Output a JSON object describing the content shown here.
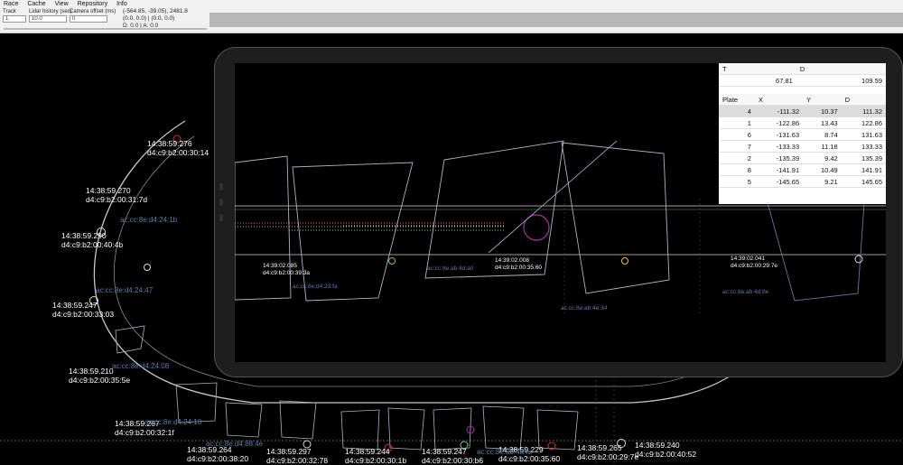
{
  "menu": [
    "Race",
    "Cache",
    "View",
    "Repository",
    "Info"
  ],
  "controls": {
    "track_label": "Track",
    "track_value": "1",
    "lidar_label": "Lidar history (sec)",
    "lidar_value": "10.0",
    "camera_label": "Camera offset (ms)",
    "camera_value": "0",
    "readout_line1": "(-564.85, -39.05), 2481.8",
    "readout_line2": "(0.0, 0.0) | (0.0, 0.0)",
    "readout_line3": "D: 0.0 | A: 0.0"
  },
  "scene_labels": [
    {
      "time": "14:38:59.276",
      "id": "d4:c9:b2:00:30:14"
    },
    {
      "time": "14:38:59.270",
      "id": "d4:c9:b2:00:31:7d"
    },
    {
      "time": "14:38:59.290",
      "id": "d4:c9:b2:00:40:4b"
    },
    {
      "time": "14:38:59.247",
      "id": "d4:c9:b2:00:33:03"
    },
    {
      "time": "14:38:59.210",
      "id": "d4:c9:b2:00:35:5e"
    },
    {
      "time": "14:38:59.267",
      "id": "d4:c9:b2:00:32:1f"
    },
    {
      "time": "14:38:59.264",
      "id": "d4:c9:b2:00:38:20"
    },
    {
      "time": "14:38:59.297",
      "id": "d4:c9:b2:00:32:78"
    },
    {
      "time": "14:38:59.244",
      "id": "d4:c9:b2:00:30:1b"
    },
    {
      "time": "14:38:59.247",
      "id": "d4:c9:b2:00:30:b6"
    },
    {
      "time": "14:38:59.229",
      "id": "d4:c9:b2:00:35:60"
    },
    {
      "time": "14:38:59.265",
      "id": "d4:c9:b2:00:29:7e"
    },
    {
      "time": "14:38:59.240",
      "id": "d4:c9:b2:00:40:52"
    }
  ],
  "scene_macs": [
    "ac:cc:8e:d4:24:1b",
    "ac:cc:8e:d4:24:47",
    "ac:cc:8e:d4:24:08",
    "ac:cc:8e:d4:24:10",
    "ac:cc:8e:d4:88:4e",
    "ac:cc:8e:ab:4d:fa"
  ],
  "tablet_labels": [
    {
      "time": "14:39:02.085",
      "id": "d4:c9:b2:00:39:3a"
    },
    {
      "time": "14:39:02.008",
      "id": "d4:c9:b2:00:35:60"
    },
    {
      "time": "14:39:02.041",
      "id": "d4:c9:b2:00:29:7e"
    }
  ],
  "tablet_macs": [
    "ac:cc:8e:d4:23:fa",
    "ac:cc:8e:ab:4d:a0",
    "ac:cc:8e:ab:4e:34",
    "ac:cc:8e:ab:4d:8e"
  ],
  "summary": {
    "t_header": "T",
    "d_header": "D",
    "t_value": "67.81",
    "d_value": "109.59"
  },
  "plates": {
    "headers": [
      "Plate",
      "X",
      "Y",
      "D"
    ],
    "rows": [
      [
        "4",
        "-111.32",
        "10.37",
        "111.32"
      ],
      [
        "1",
        "-122.86",
        "13.43",
        "122.86"
      ],
      [
        "6",
        "-131.63",
        "8.74",
        "131.63"
      ],
      [
        "7",
        "-133.33",
        "11.18",
        "133.33"
      ],
      [
        "2",
        "-135.39",
        "9.42",
        "135.39"
      ],
      [
        "8",
        "-141.91",
        "10.49",
        "141.91"
      ],
      [
        "5",
        "-145.65",
        "9.21",
        "145.65"
      ]
    ]
  },
  "colors": {
    "track_line": "#c8c8c8",
    "mac_text": "#5a7fa6",
    "marker_red": "#e03030",
    "marker_green": "#60d080",
    "marker_magenta": "#b02ab0"
  }
}
